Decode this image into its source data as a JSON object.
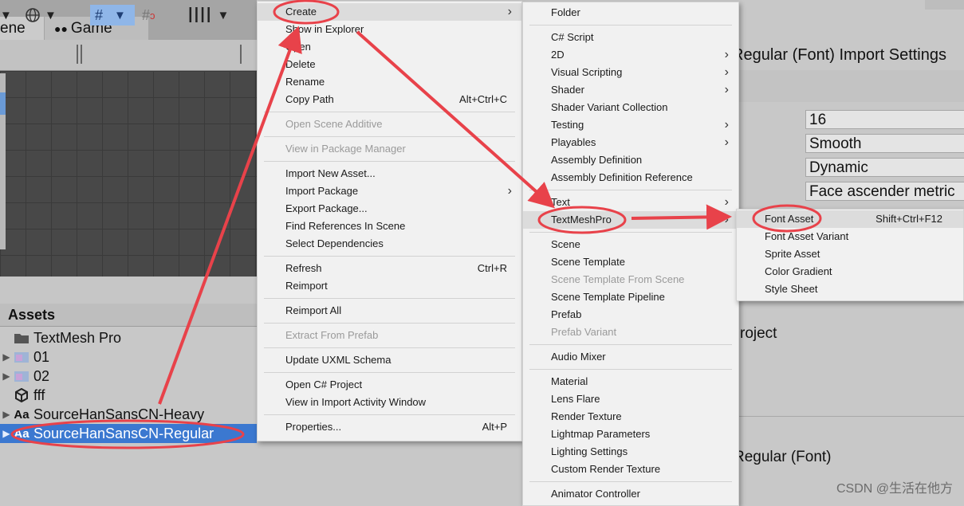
{
  "tabs": {
    "scene": "ene",
    "game": "Game"
  },
  "assets_panel": {
    "title": "Assets",
    "items": [
      {
        "label": "TextMesh Pro",
        "icon": "folder-icon",
        "arrow": ""
      },
      {
        "label": "01",
        "icon": "image-icon",
        "arrow": "▶"
      },
      {
        "label": "02",
        "icon": "image-icon",
        "arrow": "▶"
      },
      {
        "label": "fff",
        "icon": "unity-cube-icon",
        "arrow": ""
      },
      {
        "label": "SourceHanSansCN-Heavy",
        "icon": "font-icon",
        "arrow": "▶",
        "glyph": "Aa"
      },
      {
        "label": "SourceHanSansCN-Regular",
        "icon": "font-icon",
        "arrow": "▶",
        "glyph": "Aa",
        "selected": true
      }
    ]
  },
  "inspector": {
    "title": "Regular (Font) Import Settings",
    "font_size": "16",
    "rendering_mode": "Smooth",
    "character": "Dynamic",
    "line_spacing": "Face ascender metric",
    "project_text": "roject",
    "footer_title": "Regular (Font)"
  },
  "context_menu": {
    "items": [
      {
        "label": "Create",
        "submenu": true,
        "highlight": true
      },
      {
        "label": "Show in Explorer"
      },
      {
        "label": "Open"
      },
      {
        "label": "Delete"
      },
      {
        "label": "Rename"
      },
      {
        "label": "Copy Path",
        "shortcut": "Alt+Ctrl+C"
      },
      {
        "sep": true
      },
      {
        "label": "Open Scene Additive",
        "disabled": true
      },
      {
        "sep": true
      },
      {
        "label": "View in Package Manager",
        "disabled": true
      },
      {
        "sep": true
      },
      {
        "label": "Import New Asset..."
      },
      {
        "label": "Import Package",
        "submenu": true
      },
      {
        "label": "Export Package..."
      },
      {
        "label": "Find References In Scene"
      },
      {
        "label": "Select Dependencies"
      },
      {
        "sep": true
      },
      {
        "label": "Refresh",
        "shortcut": "Ctrl+R"
      },
      {
        "label": "Reimport"
      },
      {
        "sep": true
      },
      {
        "label": "Reimport All"
      },
      {
        "sep": true
      },
      {
        "label": "Extract From Prefab",
        "disabled": true
      },
      {
        "sep": true
      },
      {
        "label": "Update UXML Schema"
      },
      {
        "sep": true
      },
      {
        "label": "Open C# Project"
      },
      {
        "label": "View in Import Activity Window"
      },
      {
        "sep": true
      },
      {
        "label": "Properties...",
        "shortcut": "Alt+P"
      }
    ]
  },
  "create_submenu": {
    "items": [
      {
        "label": "Folder"
      },
      {
        "sep": true
      },
      {
        "label": "C# Script"
      },
      {
        "label": "2D",
        "submenu": true
      },
      {
        "label": "Visual Scripting",
        "submenu": true
      },
      {
        "label": "Shader",
        "submenu": true
      },
      {
        "label": "Shader Variant Collection"
      },
      {
        "label": "Testing",
        "submenu": true
      },
      {
        "label": "Playables",
        "submenu": true
      },
      {
        "label": "Assembly Definition"
      },
      {
        "label": "Assembly Definition Reference"
      },
      {
        "sep": true
      },
      {
        "label": "Text",
        "submenu": true
      },
      {
        "label": "TextMeshPro",
        "submenu": true,
        "highlight": true
      },
      {
        "sep": true
      },
      {
        "label": "Scene"
      },
      {
        "label": "Scene Template"
      },
      {
        "label": "Scene Template From Scene",
        "disabled": true
      },
      {
        "label": "Scene Template Pipeline"
      },
      {
        "label": "Prefab"
      },
      {
        "label": "Prefab Variant",
        "disabled": true
      },
      {
        "sep": true
      },
      {
        "label": "Audio Mixer"
      },
      {
        "sep": true
      },
      {
        "label": "Material"
      },
      {
        "label": "Lens Flare"
      },
      {
        "label": "Render Texture"
      },
      {
        "label": "Lightmap Parameters"
      },
      {
        "label": "Lighting Settings"
      },
      {
        "label": "Custom Render Texture"
      },
      {
        "sep": true
      },
      {
        "label": "Animator Controller"
      }
    ]
  },
  "tmp_submenu": {
    "items": [
      {
        "label": "Font Asset",
        "shortcut": "Shift+Ctrl+F12",
        "highlight": true
      },
      {
        "label": "Font Asset Variant"
      },
      {
        "label": "Sprite Asset"
      },
      {
        "label": "Color Gradient"
      },
      {
        "label": "Style Sheet"
      }
    ]
  },
  "colors": {
    "annotation": "#e8424a",
    "selection": "#3b78d0"
  },
  "watermark": "CSDN @生活在他方"
}
